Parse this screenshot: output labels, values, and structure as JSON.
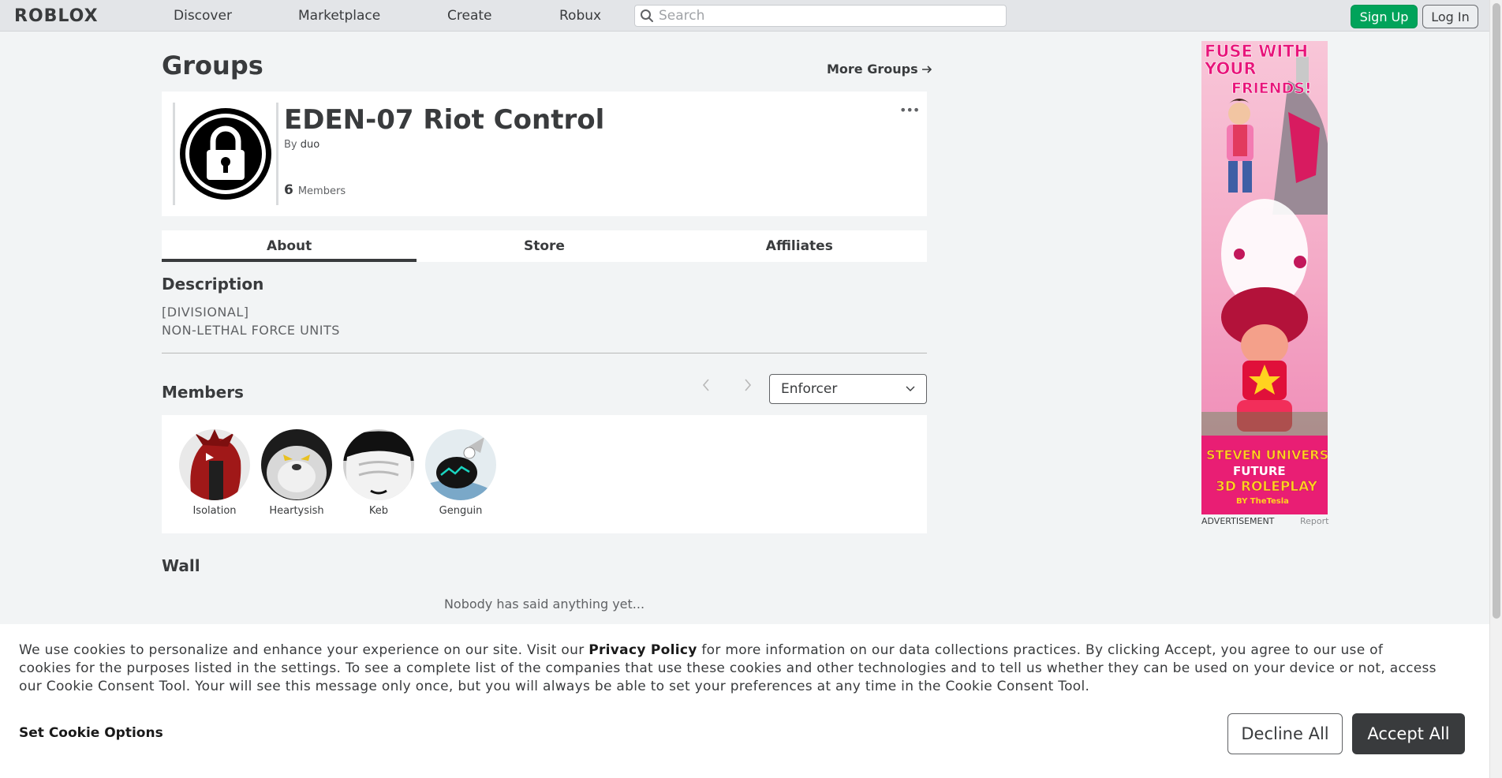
{
  "nav": {
    "logo": "ROBLOX",
    "links": [
      "Discover",
      "Marketplace",
      "Create",
      "Robux"
    ],
    "search_placeholder": "Search",
    "signup": "Sign Up",
    "login": "Log In"
  },
  "page": {
    "title": "Groups",
    "more_groups": "More Groups"
  },
  "group": {
    "name": "EDEN-07 Riot Control",
    "by_prefix": "By",
    "owner": "duo",
    "member_count": "6",
    "member_label": "Members",
    "more_menu": "•••"
  },
  "tabs": [
    "About",
    "Store",
    "Affiliates"
  ],
  "about": {
    "description_heading": "Description",
    "description_lines": [
      "[DIVISIONAL]",
      "NON-LETHAL FORCE UNITS"
    ],
    "members_heading": "Members",
    "role_selected": "Enforcer",
    "members": [
      {
        "name": "Isolation",
        "color": "#b22222"
      },
      {
        "name": "Heartysish",
        "color": "#2a2a2a"
      },
      {
        "name": "Keb",
        "color": "#cfcfcf"
      },
      {
        "name": "Genguin",
        "color": "#8fb7cf"
      }
    ],
    "wall_heading": "Wall",
    "wall_empty": "Nobody has said anything yet..."
  },
  "ad": {
    "label": "ADVERTISEMENT",
    "report": "Report",
    "headline": "FUSE WITH YOUR FRIENDS!",
    "footer_title": "STEVEN UNIVERSE FUTURE",
    "footer_sub": "3D ROLEPLAY",
    "footer_by": "BY TheTesla"
  },
  "cookie": {
    "text_before": "We use cookies to personalize and enhance your experience on our site. Visit our ",
    "link": "Privacy Policy",
    "text_after": " for more information on our data collections practices. By clicking Accept, you agree to our use of cookies for the purposes listed in the settings. To see a complete list of the companies that use these cookies and other technologies and to tell us whether they can be used on your device or not, access our Cookie Consent Tool. Your will see this message only once, but you will always be able to set your preferences at any time in the Cookie Consent Tool.",
    "options": "Set Cookie Options",
    "decline": "Decline All",
    "accept": "Accept All"
  },
  "colors": {
    "accent_green": "#00a35a",
    "text_dark": "#393b3d",
    "bg": "#f2f4f5"
  }
}
